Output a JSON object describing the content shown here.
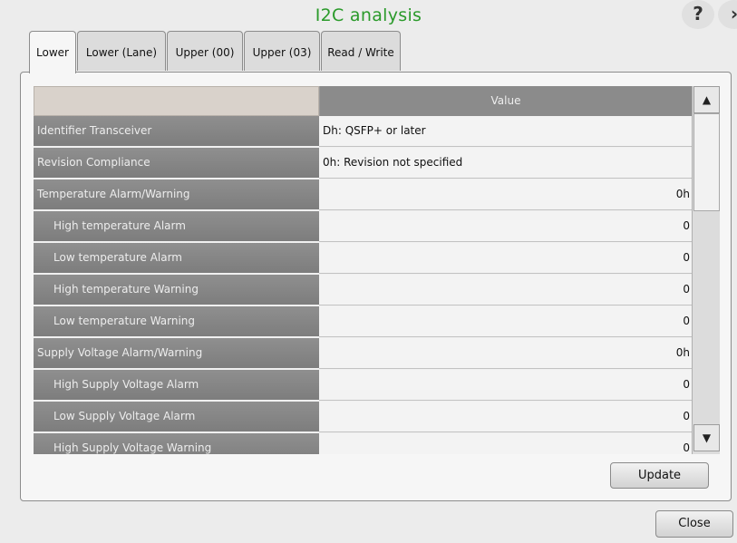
{
  "window": {
    "title": "I2C analysis",
    "help_label": "?",
    "next_label": "›"
  },
  "tabs": [
    {
      "label": "Lower",
      "active": true
    },
    {
      "label": "Lower (Lane)",
      "active": false
    },
    {
      "label": "Upper (00)",
      "active": false
    },
    {
      "label": "Upper (03)",
      "active": false
    },
    {
      "label": "Read / Write",
      "active": false
    }
  ],
  "table": {
    "columns": {
      "name": "",
      "value": "Value"
    },
    "rows": [
      {
        "name": "Identifier Transceiver",
        "value": "Dh: QSFP+ or later"
      },
      {
        "name": "Revision Compliance",
        "value": "0h: Revision not specified"
      },
      {
        "name": "Temperature Alarm/Warning",
        "value": "0h"
      },
      {
        "name": "High temperature Alarm",
        "value": "0"
      },
      {
        "name": "Low temperature Alarm",
        "value": "0"
      },
      {
        "name": "High temperature Warning",
        "value": "0"
      },
      {
        "name": "Low temperature Warning",
        "value": "0"
      },
      {
        "name": "Supply Voltage Alarm/Warning",
        "value": "0h"
      },
      {
        "name": "High Supply Voltage Alarm",
        "value": "0"
      },
      {
        "name": "Low Supply Voltage Alarm",
        "value": "0"
      },
      {
        "name": "High Supply Voltage Warning",
        "value": "0"
      }
    ]
  },
  "scrollbar": {
    "up_icon": "▲",
    "down_icon": "▼"
  },
  "buttons": {
    "update": "Update",
    "close": "Close"
  }
}
